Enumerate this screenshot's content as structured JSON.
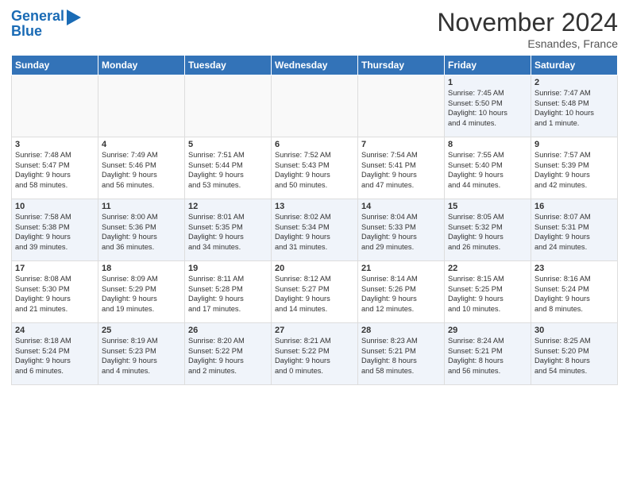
{
  "header": {
    "logo_line1": "General",
    "logo_line2": "Blue",
    "month": "November 2024",
    "location": "Esnandes, France"
  },
  "weekdays": [
    "Sunday",
    "Monday",
    "Tuesday",
    "Wednesday",
    "Thursday",
    "Friday",
    "Saturday"
  ],
  "weeks": [
    [
      {
        "day": "",
        "info": ""
      },
      {
        "day": "",
        "info": ""
      },
      {
        "day": "",
        "info": ""
      },
      {
        "day": "",
        "info": ""
      },
      {
        "day": "",
        "info": ""
      },
      {
        "day": "1",
        "info": "Sunrise: 7:45 AM\nSunset: 5:50 PM\nDaylight: 10 hours\nand 4 minutes."
      },
      {
        "day": "2",
        "info": "Sunrise: 7:47 AM\nSunset: 5:48 PM\nDaylight: 10 hours\nand 1 minute."
      }
    ],
    [
      {
        "day": "3",
        "info": "Sunrise: 7:48 AM\nSunset: 5:47 PM\nDaylight: 9 hours\nand 58 minutes."
      },
      {
        "day": "4",
        "info": "Sunrise: 7:49 AM\nSunset: 5:46 PM\nDaylight: 9 hours\nand 56 minutes."
      },
      {
        "day": "5",
        "info": "Sunrise: 7:51 AM\nSunset: 5:44 PM\nDaylight: 9 hours\nand 53 minutes."
      },
      {
        "day": "6",
        "info": "Sunrise: 7:52 AM\nSunset: 5:43 PM\nDaylight: 9 hours\nand 50 minutes."
      },
      {
        "day": "7",
        "info": "Sunrise: 7:54 AM\nSunset: 5:41 PM\nDaylight: 9 hours\nand 47 minutes."
      },
      {
        "day": "8",
        "info": "Sunrise: 7:55 AM\nSunset: 5:40 PM\nDaylight: 9 hours\nand 44 minutes."
      },
      {
        "day": "9",
        "info": "Sunrise: 7:57 AM\nSunset: 5:39 PM\nDaylight: 9 hours\nand 42 minutes."
      }
    ],
    [
      {
        "day": "10",
        "info": "Sunrise: 7:58 AM\nSunset: 5:38 PM\nDaylight: 9 hours\nand 39 minutes."
      },
      {
        "day": "11",
        "info": "Sunrise: 8:00 AM\nSunset: 5:36 PM\nDaylight: 9 hours\nand 36 minutes."
      },
      {
        "day": "12",
        "info": "Sunrise: 8:01 AM\nSunset: 5:35 PM\nDaylight: 9 hours\nand 34 minutes."
      },
      {
        "day": "13",
        "info": "Sunrise: 8:02 AM\nSunset: 5:34 PM\nDaylight: 9 hours\nand 31 minutes."
      },
      {
        "day": "14",
        "info": "Sunrise: 8:04 AM\nSunset: 5:33 PM\nDaylight: 9 hours\nand 29 minutes."
      },
      {
        "day": "15",
        "info": "Sunrise: 8:05 AM\nSunset: 5:32 PM\nDaylight: 9 hours\nand 26 minutes."
      },
      {
        "day": "16",
        "info": "Sunrise: 8:07 AM\nSunset: 5:31 PM\nDaylight: 9 hours\nand 24 minutes."
      }
    ],
    [
      {
        "day": "17",
        "info": "Sunrise: 8:08 AM\nSunset: 5:30 PM\nDaylight: 9 hours\nand 21 minutes."
      },
      {
        "day": "18",
        "info": "Sunrise: 8:09 AM\nSunset: 5:29 PM\nDaylight: 9 hours\nand 19 minutes."
      },
      {
        "day": "19",
        "info": "Sunrise: 8:11 AM\nSunset: 5:28 PM\nDaylight: 9 hours\nand 17 minutes."
      },
      {
        "day": "20",
        "info": "Sunrise: 8:12 AM\nSunset: 5:27 PM\nDaylight: 9 hours\nand 14 minutes."
      },
      {
        "day": "21",
        "info": "Sunrise: 8:14 AM\nSunset: 5:26 PM\nDaylight: 9 hours\nand 12 minutes."
      },
      {
        "day": "22",
        "info": "Sunrise: 8:15 AM\nSunset: 5:25 PM\nDaylight: 9 hours\nand 10 minutes."
      },
      {
        "day": "23",
        "info": "Sunrise: 8:16 AM\nSunset: 5:24 PM\nDaylight: 9 hours\nand 8 minutes."
      }
    ],
    [
      {
        "day": "24",
        "info": "Sunrise: 8:18 AM\nSunset: 5:24 PM\nDaylight: 9 hours\nand 6 minutes."
      },
      {
        "day": "25",
        "info": "Sunrise: 8:19 AM\nSunset: 5:23 PM\nDaylight: 9 hours\nand 4 minutes."
      },
      {
        "day": "26",
        "info": "Sunrise: 8:20 AM\nSunset: 5:22 PM\nDaylight: 9 hours\nand 2 minutes."
      },
      {
        "day": "27",
        "info": "Sunrise: 8:21 AM\nSunset: 5:22 PM\nDaylight: 9 hours\nand 0 minutes."
      },
      {
        "day": "28",
        "info": "Sunrise: 8:23 AM\nSunset: 5:21 PM\nDaylight: 8 hours\nand 58 minutes."
      },
      {
        "day": "29",
        "info": "Sunrise: 8:24 AM\nSunset: 5:21 PM\nDaylight: 8 hours\nand 56 minutes."
      },
      {
        "day": "30",
        "info": "Sunrise: 8:25 AM\nSunset: 5:20 PM\nDaylight: 8 hours\nand 54 minutes."
      }
    ]
  ]
}
